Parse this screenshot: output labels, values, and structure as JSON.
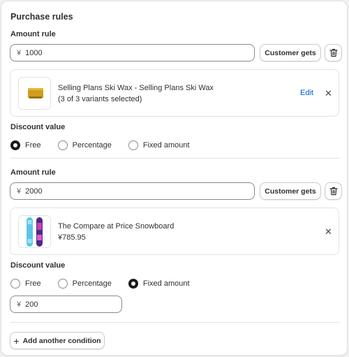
{
  "section_title": "Purchase rules",
  "rules": [
    {
      "amount_rule_label": "Amount rule",
      "currency_symbol": "¥",
      "amount": "1000",
      "customer_gets_label": "Customer gets",
      "product": {
        "name": "Selling Plans Ski Wax - Selling Plans Ski Wax",
        "detail": "(3 of 3 variants selected)",
        "edit_label": "Edit",
        "thumbnail_icon": "ski-wax-thumbnail"
      },
      "discount_label": "Discount value",
      "options": [
        "Free",
        "Percentage",
        "Fixed amount"
      ],
      "selected": "Free"
    },
    {
      "amount_rule_label": "Amount rule",
      "currency_symbol": "¥",
      "amount": "2000",
      "customer_gets_label": "Customer gets",
      "product": {
        "name": "The Compare at Price Snowboard",
        "detail": "¥785.95",
        "thumbnail_icon": "snowboard-thumbnail"
      },
      "discount_label": "Discount value",
      "options": [
        "Free",
        "Percentage",
        "Fixed amount"
      ],
      "selected": "Fixed amount",
      "fixed_amount": {
        "currency_symbol": "¥",
        "value": "200"
      }
    }
  ],
  "add_condition_label": "Add another condition",
  "icons": {
    "delete": "trash-icon",
    "remove": "close-icon",
    "add": "plus-icon"
  },
  "colors": {
    "link": "#005bd3",
    "radio_selected": "#1a1a1a"
  }
}
